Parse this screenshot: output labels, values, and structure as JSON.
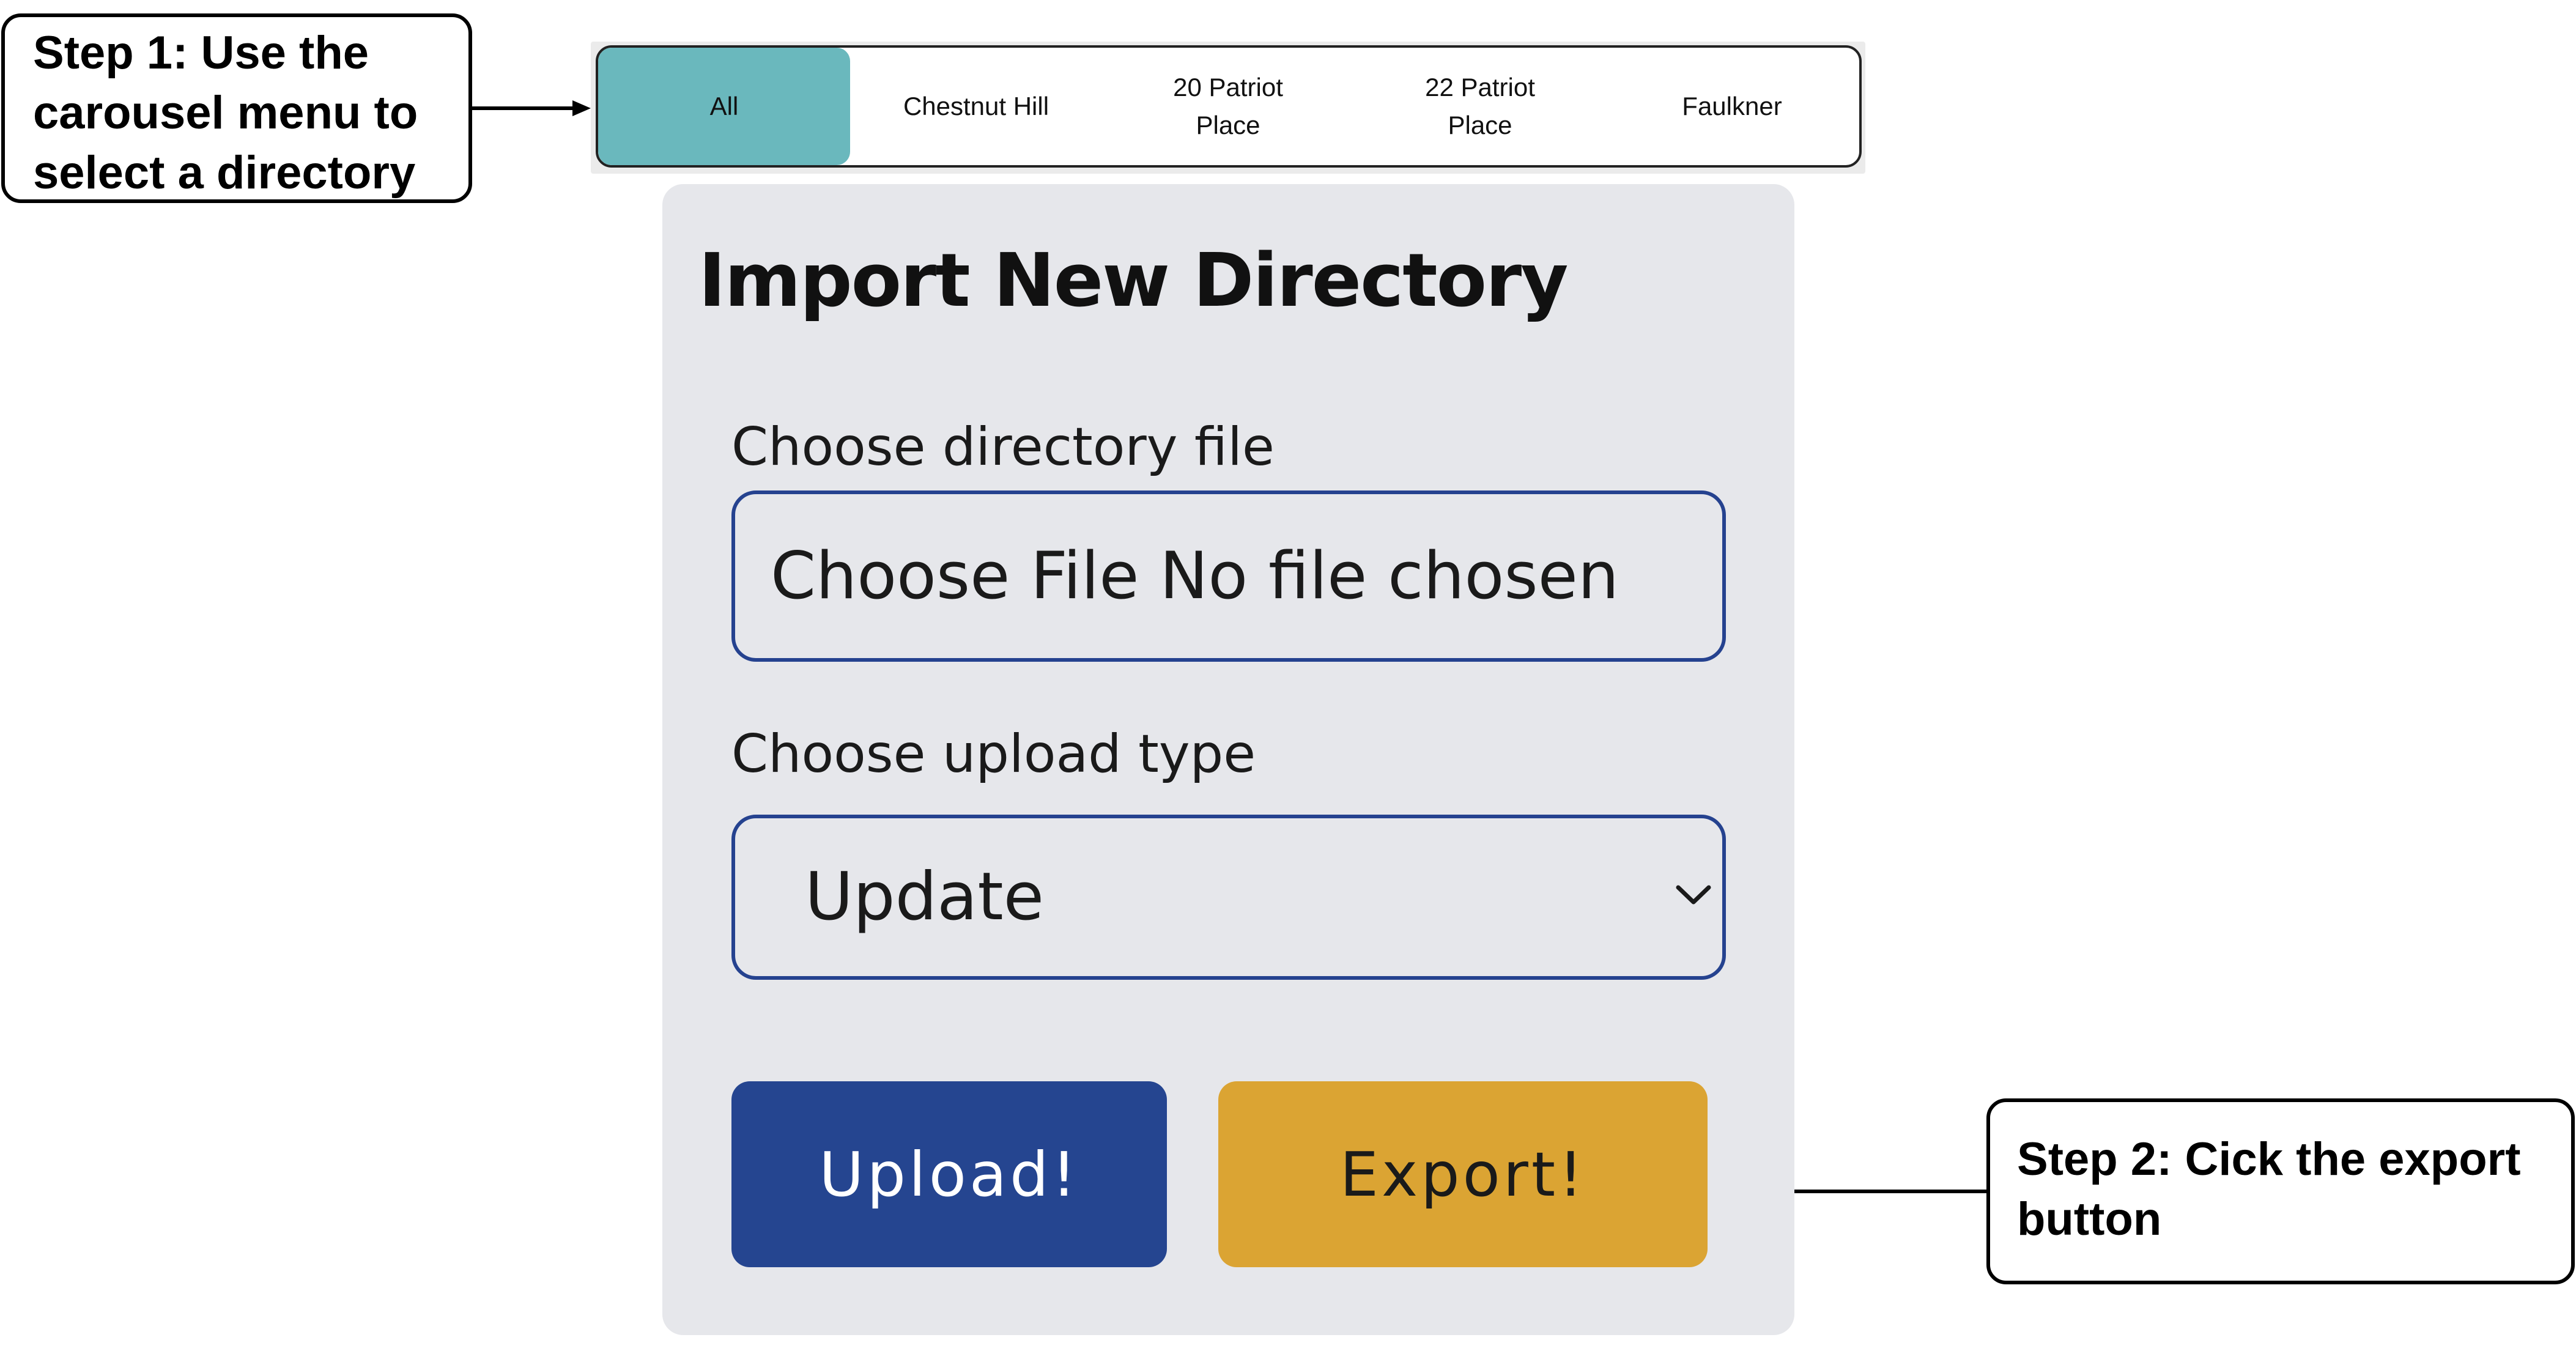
{
  "annotations": {
    "step1": [
      "Step 1: Use the",
      "carousel menu to",
      "select a directory"
    ],
    "step2": [
      "Step 2: Cick the export",
      "button"
    ]
  },
  "carousel": {
    "items": [
      {
        "label": "All",
        "active": true
      },
      {
        "label": "Chestnut Hill",
        "active": false
      },
      {
        "label": "20 Patriot Place",
        "active": false
      },
      {
        "label": "22 Patriot Place",
        "active": false
      },
      {
        "label": "Faulkner",
        "active": false
      }
    ]
  },
  "panel": {
    "title": "Import New Directory",
    "file_label": "Choose directory file",
    "file_input_text": "Choose File No file chosen",
    "upload_type_label": "Choose upload type",
    "upload_type_value": "Update",
    "upload_button": "Upload!",
    "export_button": "Export!"
  },
  "icons": {
    "select_arrow": "chevron-down-icon"
  },
  "colors": {
    "carousel_active": "#6ab8bd",
    "panel_bg": "#e6e7eb",
    "input_border": "#25428f",
    "upload_button": "#254590",
    "export_button": "#dba433"
  }
}
